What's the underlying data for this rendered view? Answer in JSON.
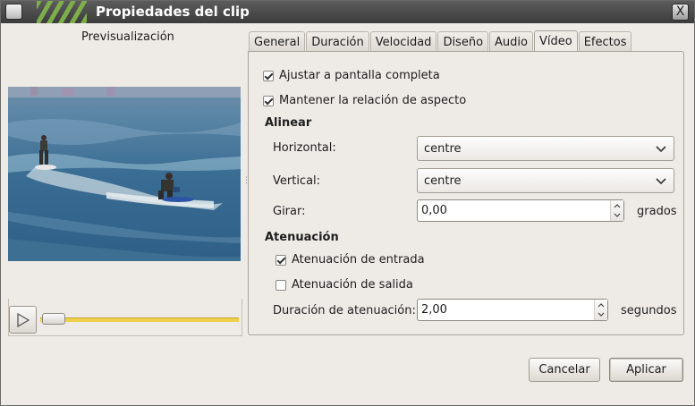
{
  "window": {
    "title": "Propiedades del clip",
    "close_glyph": "X"
  },
  "preview": {
    "label": "Previsualización",
    "image": "surfing-video-frame"
  },
  "tabs": [
    {
      "label": "General"
    },
    {
      "label": "Duración"
    },
    {
      "label": "Velocidad"
    },
    {
      "label": "Diseño"
    },
    {
      "label": "Audio"
    },
    {
      "label": "Vídeo",
      "active": true
    },
    {
      "label": "Efectos"
    }
  ],
  "video": {
    "fit_screen": {
      "label": "Ajustar a pantalla completa",
      "checked": true
    },
    "keep_aspect": {
      "label": "Mantener la relación de aspecto",
      "checked": true
    },
    "align_section": "Alinear",
    "horizontal": {
      "label": "Horizontal:",
      "value": "centre"
    },
    "vertical": {
      "label": "Vertical:",
      "value": "centre"
    },
    "rotate": {
      "label": "Girar:",
      "value": "0,00",
      "unit": "grados"
    },
    "fade_section": "Atenuación",
    "fade_in": {
      "label": "Atenuación de entrada",
      "checked": true
    },
    "fade_out": {
      "label": "Atenuación de salida",
      "checked": false
    },
    "fade_duration": {
      "label": "Duración de atenuación:",
      "value": "2,00",
      "unit": "segundos"
    }
  },
  "buttons": {
    "cancel": "Cancelar",
    "apply": "Aplicar"
  },
  "colors": {
    "titlebar": "#4a4a4a",
    "accent": "#7fb34a",
    "progress": "#efd04a",
    "window_bg": "#eeebe7"
  }
}
